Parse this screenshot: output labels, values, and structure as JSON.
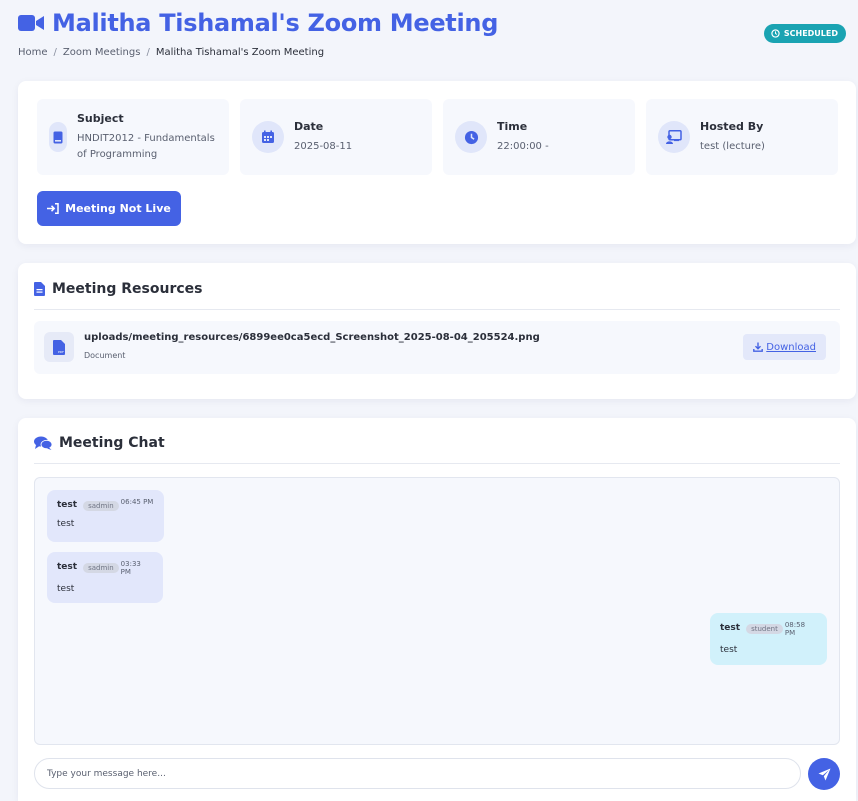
{
  "header": {
    "title": "Malitha Tishamal's Zoom Meeting",
    "title_icon": "video-camera-icon",
    "status_badge": "SCHEDULED",
    "breadcrumb": [
      {
        "label": "Home"
      },
      {
        "label": "Zoom Meetings"
      },
      {
        "label": "Malitha Tishamal's Zoom Meeting"
      }
    ],
    "breadcrumb_separator": "/"
  },
  "info": {
    "subject": {
      "label": "Subject",
      "value": "HNDIT2012 - Fundamentals of Programming",
      "icon": "book-icon"
    },
    "date": {
      "label": "Date",
      "value": "2025-08-11",
      "icon": "calendar-icon"
    },
    "time": {
      "label": "Time",
      "value": "22:00:00 -",
      "icon": "clock-icon"
    },
    "host": {
      "label": "Hosted By",
      "value": "test (lecture)",
      "icon": "presenter-icon"
    },
    "join_button": "Meeting Not Live"
  },
  "resources": {
    "title": "Meeting Resources",
    "items": [
      {
        "name": "uploads/meeting_resources/6899ee0ca5ecd_Screenshot_2025-08-04_205524.png",
        "type": "Document",
        "download_label": "Download"
      }
    ]
  },
  "chat": {
    "title": "Meeting Chat",
    "messages": [
      {
        "sender": "test",
        "role": "sadmin",
        "time": "06:45 PM",
        "text": "test",
        "direction": "incoming"
      },
      {
        "sender": "test",
        "role": "sadmin",
        "time": "03:33 PM",
        "text": "test",
        "direction": "incoming"
      },
      {
        "sender": "test",
        "role": "student",
        "time": "08:58 PM",
        "text": "test",
        "direction": "outgoing"
      }
    ],
    "input_placeholder": "Type your message here...",
    "input_value": ""
  },
  "colors": {
    "accent": "#4462e4",
    "badge": "#1aa3b2",
    "incoming_bubble": "#e2e7fb",
    "outgoing_bubble": "#d1f1fb",
    "page_background": "#f3f5fb"
  }
}
